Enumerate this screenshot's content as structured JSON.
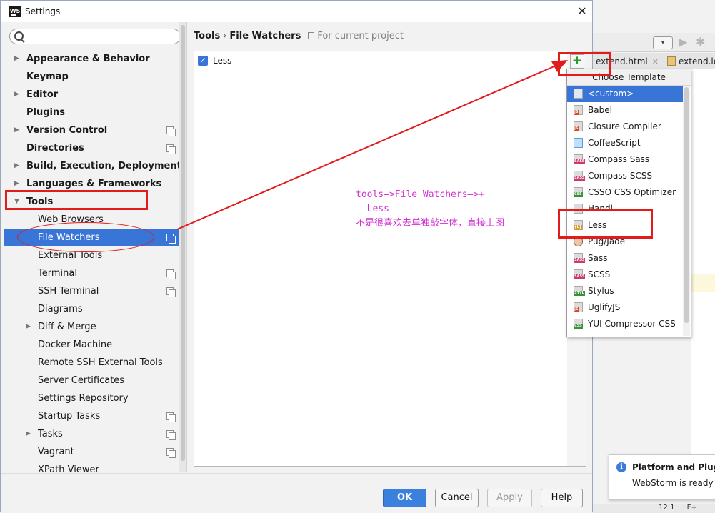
{
  "window": {
    "title": "Settings",
    "app_icon_text": "WS",
    "close_glyph": "✕"
  },
  "search": {
    "placeholder": "",
    "value": ""
  },
  "tree": [
    {
      "label": "Appearance & Behavior",
      "level": 0,
      "expandable": true,
      "copy_icon": false
    },
    {
      "label": "Keymap",
      "level": 0,
      "expandable": false,
      "copy_icon": false
    },
    {
      "label": "Editor",
      "level": 0,
      "expandable": true,
      "copy_icon": false
    },
    {
      "label": "Plugins",
      "level": 0,
      "expandable": false,
      "copy_icon": false
    },
    {
      "label": "Version Control",
      "level": 0,
      "expandable": true,
      "copy_icon": true
    },
    {
      "label": "Directories",
      "level": 0,
      "expandable": false,
      "copy_icon": true
    },
    {
      "label": "Build, Execution, Deployment",
      "level": 0,
      "expandable": true,
      "copy_icon": false
    },
    {
      "label": "Languages & Frameworks",
      "level": 0,
      "expandable": true,
      "copy_icon": false
    },
    {
      "label": "Tools",
      "level": 0,
      "expandable": true,
      "expanded": true,
      "copy_icon": false
    },
    {
      "label": "Web Browsers",
      "level": 1,
      "expandable": false,
      "copy_icon": false
    },
    {
      "label": "File Watchers",
      "level": 1,
      "expandable": false,
      "copy_icon": true,
      "selected": true
    },
    {
      "label": "External Tools",
      "level": 1,
      "expandable": false,
      "copy_icon": false
    },
    {
      "label": "Terminal",
      "level": 1,
      "expandable": false,
      "copy_icon": true
    },
    {
      "label": "SSH Terminal",
      "level": 1,
      "expandable": false,
      "copy_icon": true
    },
    {
      "label": "Diagrams",
      "level": 1,
      "expandable": false,
      "copy_icon": false
    },
    {
      "label": "Diff & Merge",
      "level": 1,
      "expandable": true,
      "copy_icon": false
    },
    {
      "label": "Docker Machine",
      "level": 1,
      "expandable": false,
      "copy_icon": false
    },
    {
      "label": "Remote SSH External Tools",
      "level": 1,
      "expandable": false,
      "copy_icon": false
    },
    {
      "label": "Server Certificates",
      "level": 1,
      "expandable": false,
      "copy_icon": false
    },
    {
      "label": "Settings Repository",
      "level": 1,
      "expandable": false,
      "copy_icon": false
    },
    {
      "label": "Startup Tasks",
      "level": 1,
      "expandable": false,
      "copy_icon": true
    },
    {
      "label": "Tasks",
      "level": 1,
      "expandable": true,
      "copy_icon": true
    },
    {
      "label": "Vagrant",
      "level": 1,
      "expandable": false,
      "copy_icon": true
    },
    {
      "label": "XPath Viewer",
      "level": 1,
      "expandable": false,
      "copy_icon": false
    }
  ],
  "breadcrumb": {
    "part1": "Tools",
    "separator": "›",
    "part2": "File Watchers",
    "scope": "For current project"
  },
  "watchers": [
    {
      "label": "Less",
      "checked": true
    }
  ],
  "toolbar": {
    "add_glyph": "+"
  },
  "popup": {
    "title": "Choose Template",
    "items": [
      {
        "label": "<custom>",
        "icon": "plain",
        "tag": "",
        "tag_color": "#3d6ab4",
        "selected": true
      },
      {
        "label": "Babel",
        "icon": "js",
        "tag": "JS",
        "tag_color": "#d44b2c"
      },
      {
        "label": "Closure Compiler",
        "icon": "js",
        "tag": "JS",
        "tag_color": "#d44b2c"
      },
      {
        "label": "CoffeeScript",
        "icon": "coffee",
        "tag": "",
        "tag_color": "#3d8ed4"
      },
      {
        "label": "Compass Sass",
        "icon": "sass",
        "tag": "SASS",
        "tag_color": "#cc3a6b"
      },
      {
        "label": "Compass SCSS",
        "icon": "sass",
        "tag": "SASS",
        "tag_color": "#cc3a6b"
      },
      {
        "label": "CSSO CSS Optimizer",
        "icon": "css",
        "tag": "CSS",
        "tag_color": "#3a8f3a"
      },
      {
        "label": "Handl",
        "icon": "js",
        "tag": "",
        "tag_color": "#d4a12c"
      },
      {
        "label": "Less",
        "icon": "less",
        "tag": "{L}",
        "tag_color": "#d49a2c"
      },
      {
        "label": "Pug/Jade",
        "icon": "pug",
        "tag": "",
        "tag_color": "#8a5a3a"
      },
      {
        "label": "Sass",
        "icon": "sass",
        "tag": "SASS",
        "tag_color": "#cc3a6b"
      },
      {
        "label": "SCSS",
        "icon": "sass",
        "tag": "SASS",
        "tag_color": "#cc3a6b"
      },
      {
        "label": "Stylus",
        "icon": "styl",
        "tag": "STYL",
        "tag_color": "#3a8f3a"
      },
      {
        "label": "UglifyJS",
        "icon": "js",
        "tag": "JS",
        "tag_color": "#d44b2c"
      },
      {
        "label": "YUI Compressor CSS",
        "icon": "css",
        "tag": "CSS",
        "tag_color": "#3a8f3a"
      }
    ]
  },
  "annotation": {
    "line1": "tools—>File Watchers—>+",
    "line2": " —Less",
    "line3": "不是很喜欢去单独敲字体，直接上图",
    "color": "#d12fd1",
    "mark_color": "#e21b1b"
  },
  "buttons": {
    "ok": "OK",
    "cancel": "Cancel",
    "apply": "Apply",
    "help": "Help"
  },
  "ide": {
    "tab1": "extend.html",
    "tab2": "extend.le",
    "tab_close": "✕",
    "notification_title": "Platform and Plugi",
    "notification_body": "WebStorm is ready t",
    "status_pos": "12:1",
    "status_sep": "LF÷"
  }
}
